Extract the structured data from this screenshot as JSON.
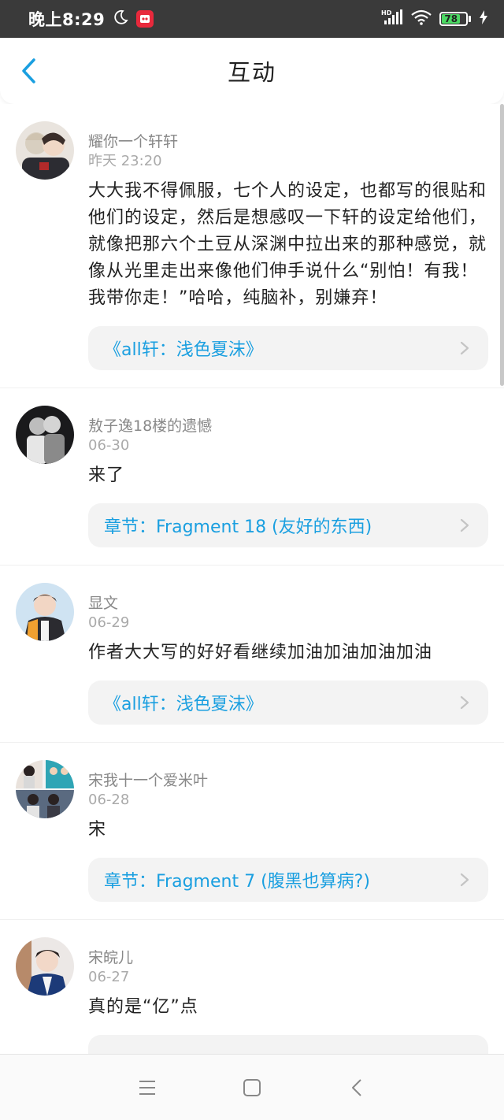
{
  "status_bar": {
    "time": "晚上8:29",
    "network_label": "HD",
    "battery": "78"
  },
  "header": {
    "title": "互动"
  },
  "comments": [
    {
      "username": "耀你一个轩轩",
      "timestamp": "昨天 23:20",
      "content": "大大我不得佩服，七个人的设定，也都写的很贴和他们的设定，然后是想感叹一下轩的设定给他们，就像把那六个土豆从深渊中拉出来的那种感觉，就像从光里走出来像他们伸手说什么“别怕！有我！我带你走！”哈哈，纯脑补，别嫌弃！",
      "reference": "《all轩：浅色夏沫》"
    },
    {
      "username": "敖子逸18楼的遗憾",
      "timestamp": "06-30",
      "content": "来了",
      "reference": "章节：Fragment 18 (友好的东西)"
    },
    {
      "username": "显文",
      "timestamp": "06-29",
      "content": "作者大大写的好好看继续加油加油加油加油",
      "reference": "《all轩：浅色夏沫》"
    },
    {
      "username": "宋我十一个爱米叶",
      "timestamp": "06-28",
      "content": "宋",
      "reference": "章节：Fragment 7 (腹黑也算病?)"
    },
    {
      "username": "宋皖儿",
      "timestamp": "06-27",
      "content": "真的是“亿”点",
      "reference": ""
    }
  ],
  "colors": {
    "accent": "#1a9fe0",
    "status_bar": "#3a3a3a",
    "card_bg": "#f3f3f3"
  }
}
